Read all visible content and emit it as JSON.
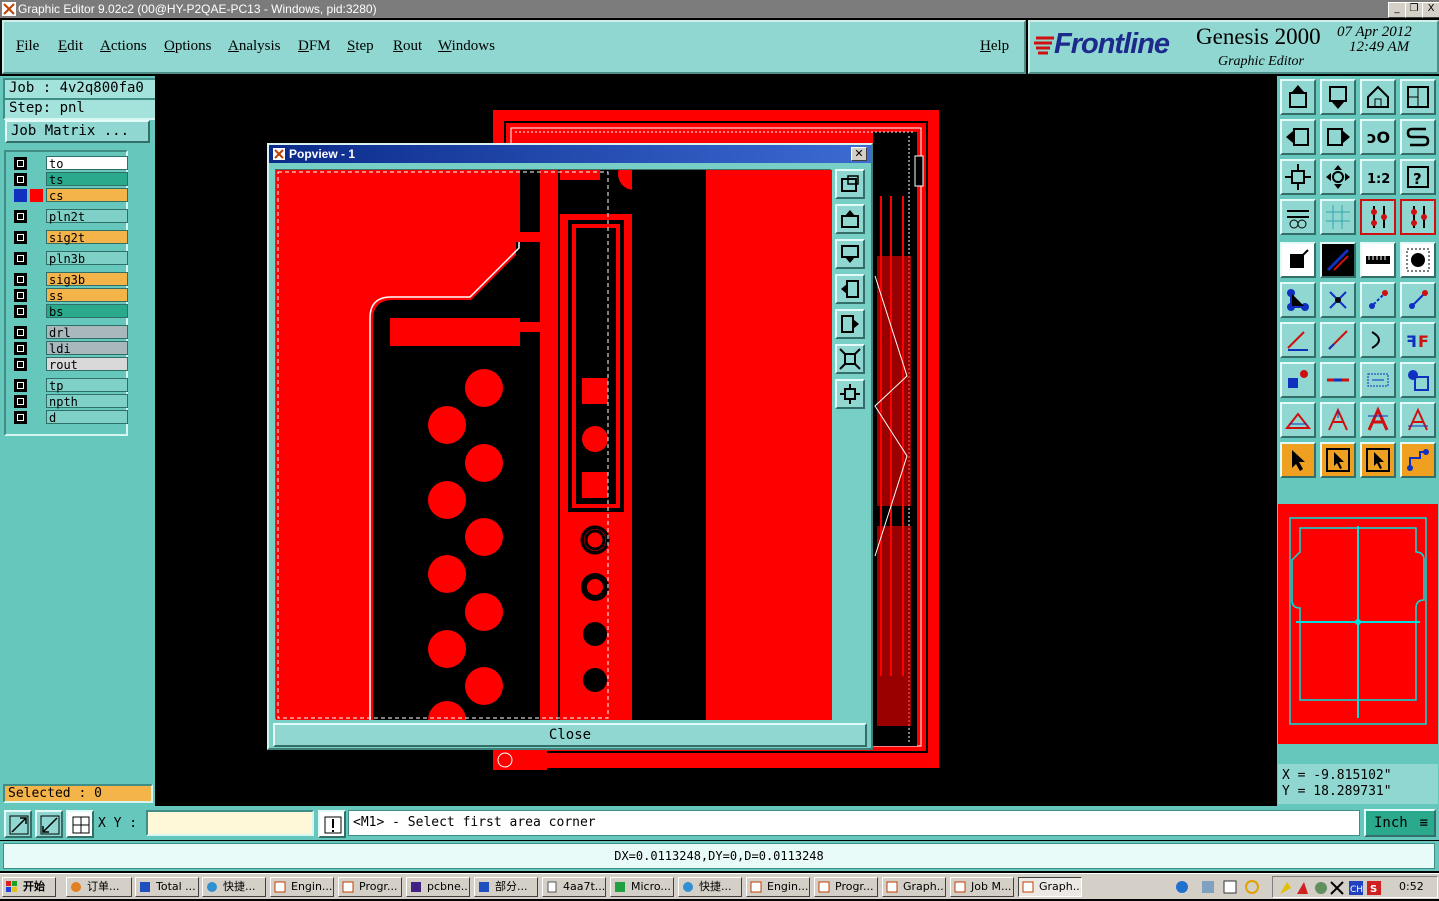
{
  "window": {
    "title": "Graphic Editor 9.02c2 (00@HY-P2QAE-PC13 - Windows, pid:3280)",
    "controls": [
      "_",
      "❐",
      "X"
    ]
  },
  "menu": {
    "items": [
      "File",
      "Edit",
      "Actions",
      "Options",
      "Analysis",
      "DFM",
      "Step",
      "Rout",
      "Windows"
    ],
    "help": "Help"
  },
  "brand": {
    "logo": "Frontline",
    "product": "Genesis 2000",
    "subtitle": "Graphic Editor",
    "date": "07 Apr 2012",
    "time": "12:49 AM"
  },
  "left_panel": {
    "job": "Job : 4v2q800fa0",
    "step": "Step: pnl",
    "job_matrix": "Job Matrix ...",
    "selected": "Selected : 0",
    "layers": [
      {
        "name": "to",
        "color": "#ffffff"
      },
      {
        "name": "ts",
        "color": "#2aa98c"
      },
      {
        "name": "cs",
        "color": "#f5b44a"
      },
      {
        "name": "pln2t",
        "color": "#7fd0c6"
      },
      {
        "name": "sig2t",
        "color": "#f5b44a"
      },
      {
        "name": "pln3b",
        "color": "#7fd0c6"
      },
      {
        "name": "sig3b",
        "color": "#f5b44a"
      },
      {
        "name": "ss",
        "color": "#f5b44a"
      },
      {
        "name": "bs",
        "color": "#2aa98c"
      },
      {
        "name": "drl",
        "color": "#a8b8bc"
      },
      {
        "name": "ldi",
        "color": "#a8b8bc"
      },
      {
        "name": "rout",
        "color": "#d9d9d9"
      },
      {
        "name": "tp",
        "color": "#7fd0c6"
      },
      {
        "name": "npth",
        "color": "#7fd0c6"
      },
      {
        "name": "d",
        "color": "#7fd0c6"
      }
    ]
  },
  "popview": {
    "title": "Popview - 1",
    "close_label": "Close"
  },
  "coords": {
    "x": "X = -9.815102\"",
    "y": "Y = 18.289731\""
  },
  "command": {
    "xy_label": "X Y :",
    "xy_value": "",
    "prompt": "<M1> - Select first area corner",
    "unit": "Inch"
  },
  "status": {
    "measure": "DX=0.0113248,DY=0,D=0.0113248"
  },
  "taskbar": {
    "start": "开始",
    "tasks": [
      "订单...",
      "Total ...",
      "快捷...",
      "Engin...",
      "Progr...",
      "pcbne...",
      "部分...",
      "4aa7t...",
      "Micro...",
      "快捷...",
      "Engin...",
      "Progr...",
      "Graph...",
      "Job M...",
      "Graph..."
    ],
    "clock": "0:52"
  },
  "colors": {
    "panel": "#66c7bc",
    "menu": "#8fd7d0",
    "copper": "#ff0000",
    "highlight": "#00e0e0"
  }
}
